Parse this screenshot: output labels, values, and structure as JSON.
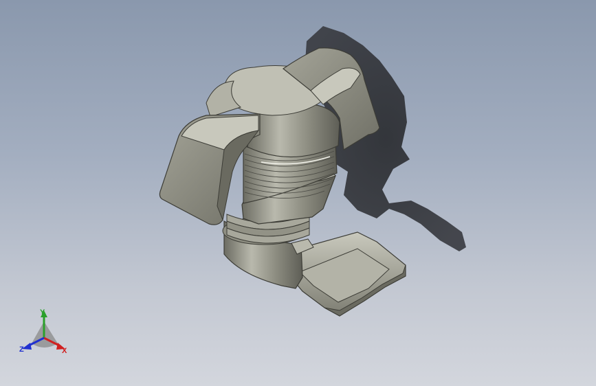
{
  "viewport": {
    "background_top": "#8a98ad",
    "background_bottom": "#d3d6dd",
    "model_color": "#8e8e82"
  },
  "triad": {
    "x_label": "X",
    "y_label": "Y",
    "z_label": "Z",
    "x_color": "#d02020",
    "y_color": "#2aa02a",
    "z_color": "#2030d0"
  }
}
